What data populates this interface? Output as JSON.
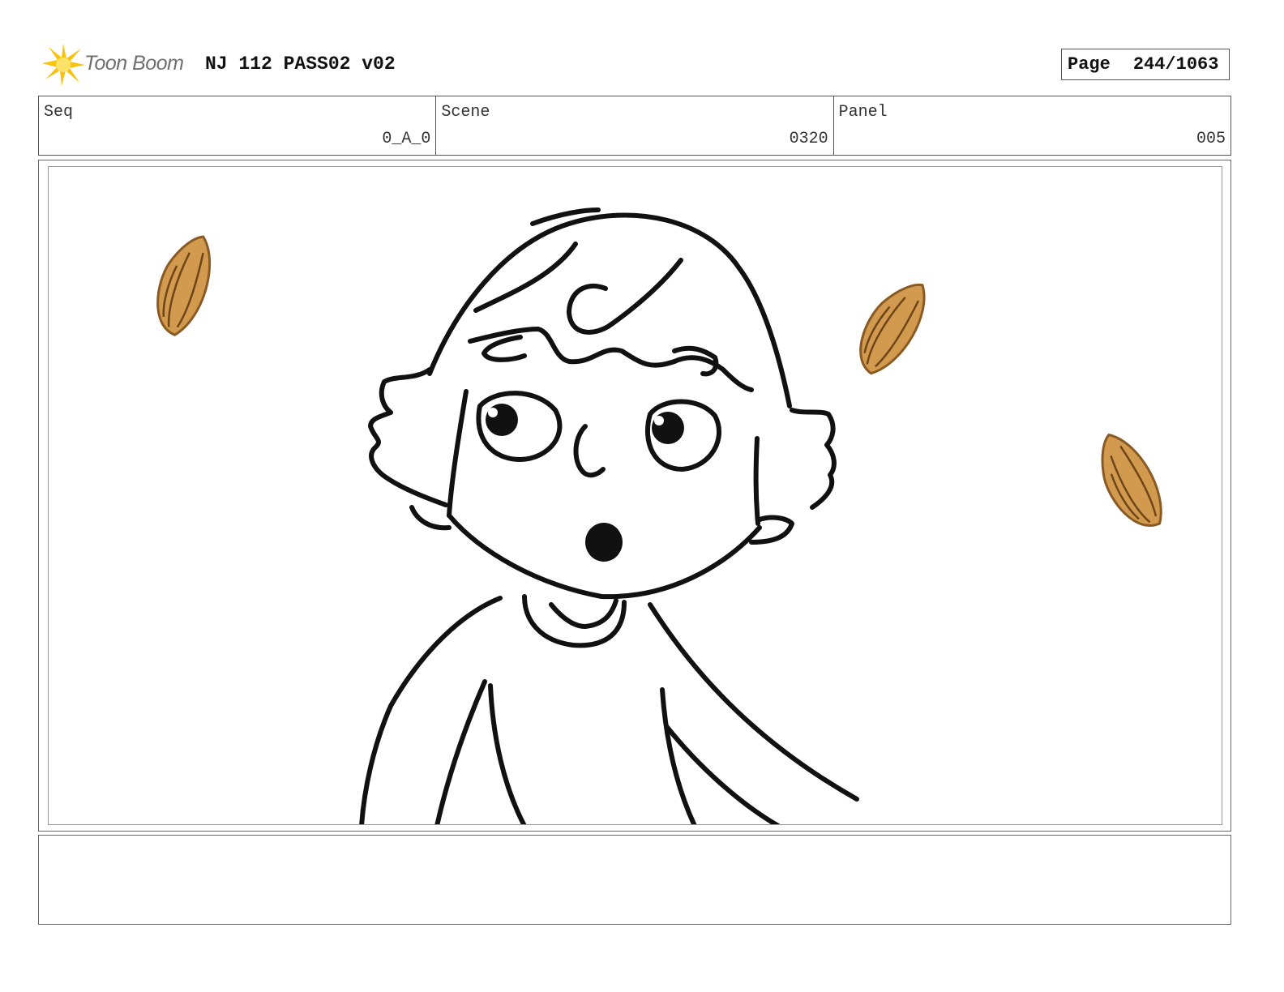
{
  "header": {
    "logo_text": "Toon Boom",
    "title": "NJ 112 PASS02 v02",
    "page_label": "Page",
    "page_number": "244/1063"
  },
  "info": {
    "seq": {
      "label": "Seq",
      "value": "0_A_0"
    },
    "scene": {
      "label": "Scene",
      "value": "0320"
    },
    "panel": {
      "label": "Panel",
      "value": "005"
    }
  },
  "artwork": {
    "line_color": "#111111",
    "almond_fill": "#d29a4e",
    "almond_stroke": "#8a5a24",
    "almonds": 3
  },
  "notes": {
    "text": ""
  }
}
